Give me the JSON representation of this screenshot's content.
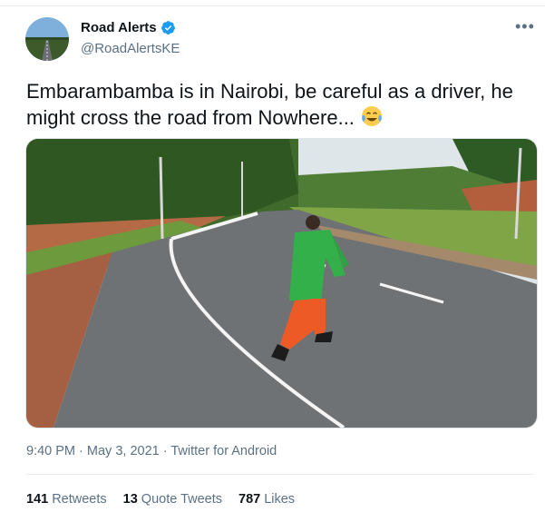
{
  "author": {
    "display_name": "Road Alerts",
    "handle": "@RoadAlertsKE",
    "verified_icon": "verified-badge-icon",
    "avatar_icon": "road-avatar"
  },
  "tweet": {
    "text": "Embarambamba is in Nairobi, be careful as a driver, he might cross the road from Nowhere...",
    "emoji": "face-with-tears-of-joy-icon",
    "media_icon": "road-photo"
  },
  "meta": {
    "time": "9:40 PM",
    "separator": "·",
    "date": "May 3, 2021",
    "source": "Twitter for Android"
  },
  "stats": {
    "retweets_count": "141",
    "retweets_label": "Retweets",
    "quotes_count": "13",
    "quotes_label": "Quote Tweets",
    "likes_count": "787",
    "likes_label": "Likes"
  },
  "colors": {
    "verified": "#1d9bf0",
    "secondary_text": "#5b7083",
    "primary_text": "#0f1419"
  }
}
